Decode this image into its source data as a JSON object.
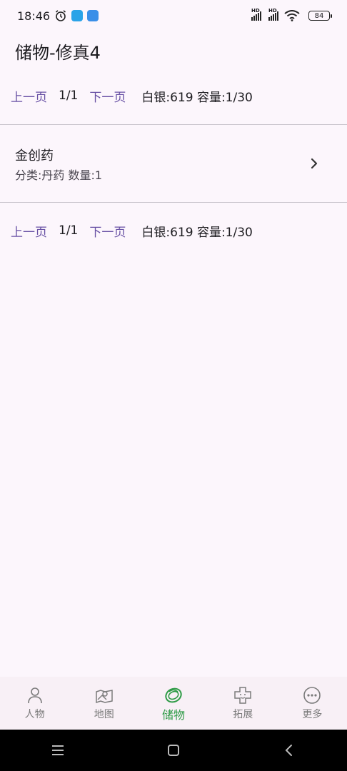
{
  "status_bar": {
    "time": "18:46",
    "battery": "84",
    "hd1": "HD",
    "hd2": "HD"
  },
  "page": {
    "title": "储物-修真4"
  },
  "pager_top": {
    "prev": "上一页",
    "page": "1/1",
    "next": "下一页",
    "info": "白银:619 容量:1/30"
  },
  "items": [
    {
      "name": "金创药",
      "meta": "分类:丹药 数量:1"
    }
  ],
  "pager_bottom": {
    "prev": "上一页",
    "page": "1/1",
    "next": "下一页",
    "info": "白银:619 容量:1/30"
  },
  "bottom_nav": [
    {
      "label": "人物",
      "icon": "person-icon"
    },
    {
      "label": "地图",
      "icon": "map-icon"
    },
    {
      "label": "储物",
      "icon": "storage-ring-icon",
      "active": true
    },
    {
      "label": "拓展",
      "icon": "puzzle-icon"
    },
    {
      "label": "更多",
      "icon": "more-icon"
    }
  ],
  "colors": {
    "accent": "#6750a4",
    "active_nav": "#2e9b46",
    "background": "#fcf6fc"
  }
}
